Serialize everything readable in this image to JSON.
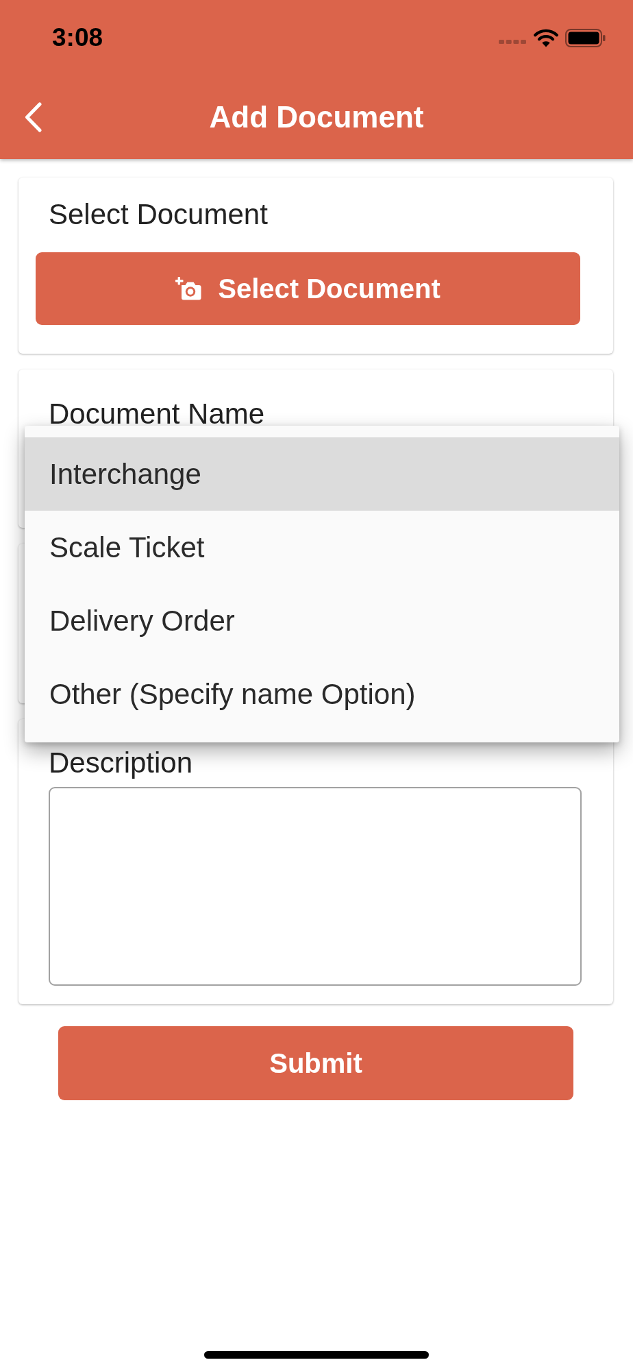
{
  "status_bar": {
    "time": "3:08"
  },
  "app_bar": {
    "title": "Add Document"
  },
  "cards": [
    {
      "kind": "upload",
      "label": "Select Document",
      "button": "Select Document"
    },
    {
      "kind": "dropdown",
      "label": "Document Name"
    },
    {
      "kind": "blank"
    },
    {
      "kind": "textarea",
      "label": "Description"
    }
  ],
  "dropdown_menu": {
    "options": [
      {
        "label": "Interchange",
        "selected": true
      },
      {
        "label": "Scale Ticket",
        "selected": false
      },
      {
        "label": "Delivery Order",
        "selected": false
      },
      {
        "label": "Other (Specify name Option)",
        "selected": false
      }
    ]
  },
  "submit_button": "Submit"
}
